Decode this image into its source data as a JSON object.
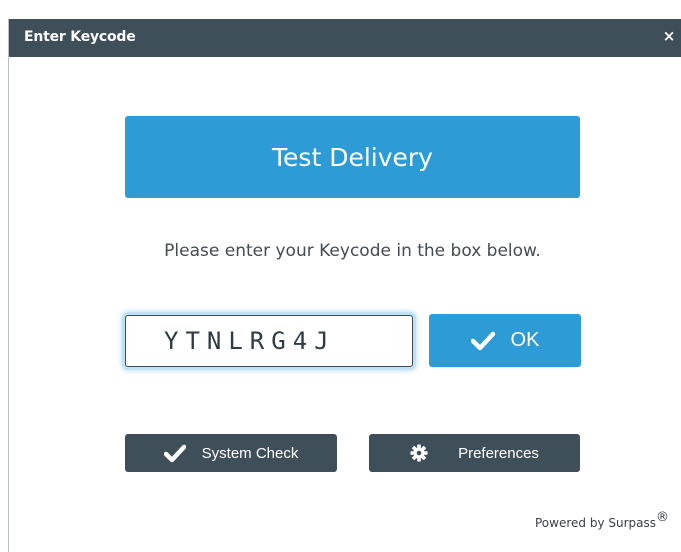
{
  "dialog": {
    "title": "Enter Keycode",
    "close_symbol": "×"
  },
  "banner": {
    "text": "Test Delivery"
  },
  "instruction": "Please enter your Keycode in the box below.",
  "keycode": {
    "value": "YTNLRG4J"
  },
  "ok_button": {
    "label": "OK",
    "icon": "checkmark-icon"
  },
  "system_check_button": {
    "label": "System Check",
    "icon": "checkmark-icon"
  },
  "preferences_button": {
    "label": "Preferences",
    "icon": "gear-icon"
  },
  "footer": {
    "powered_by": "Powered by Surpass",
    "registered_mark": "®"
  },
  "colors": {
    "titlebar": "#3f4f5a",
    "accent_blue": "#2c9bd6",
    "dark_button": "#3f4f5a"
  }
}
